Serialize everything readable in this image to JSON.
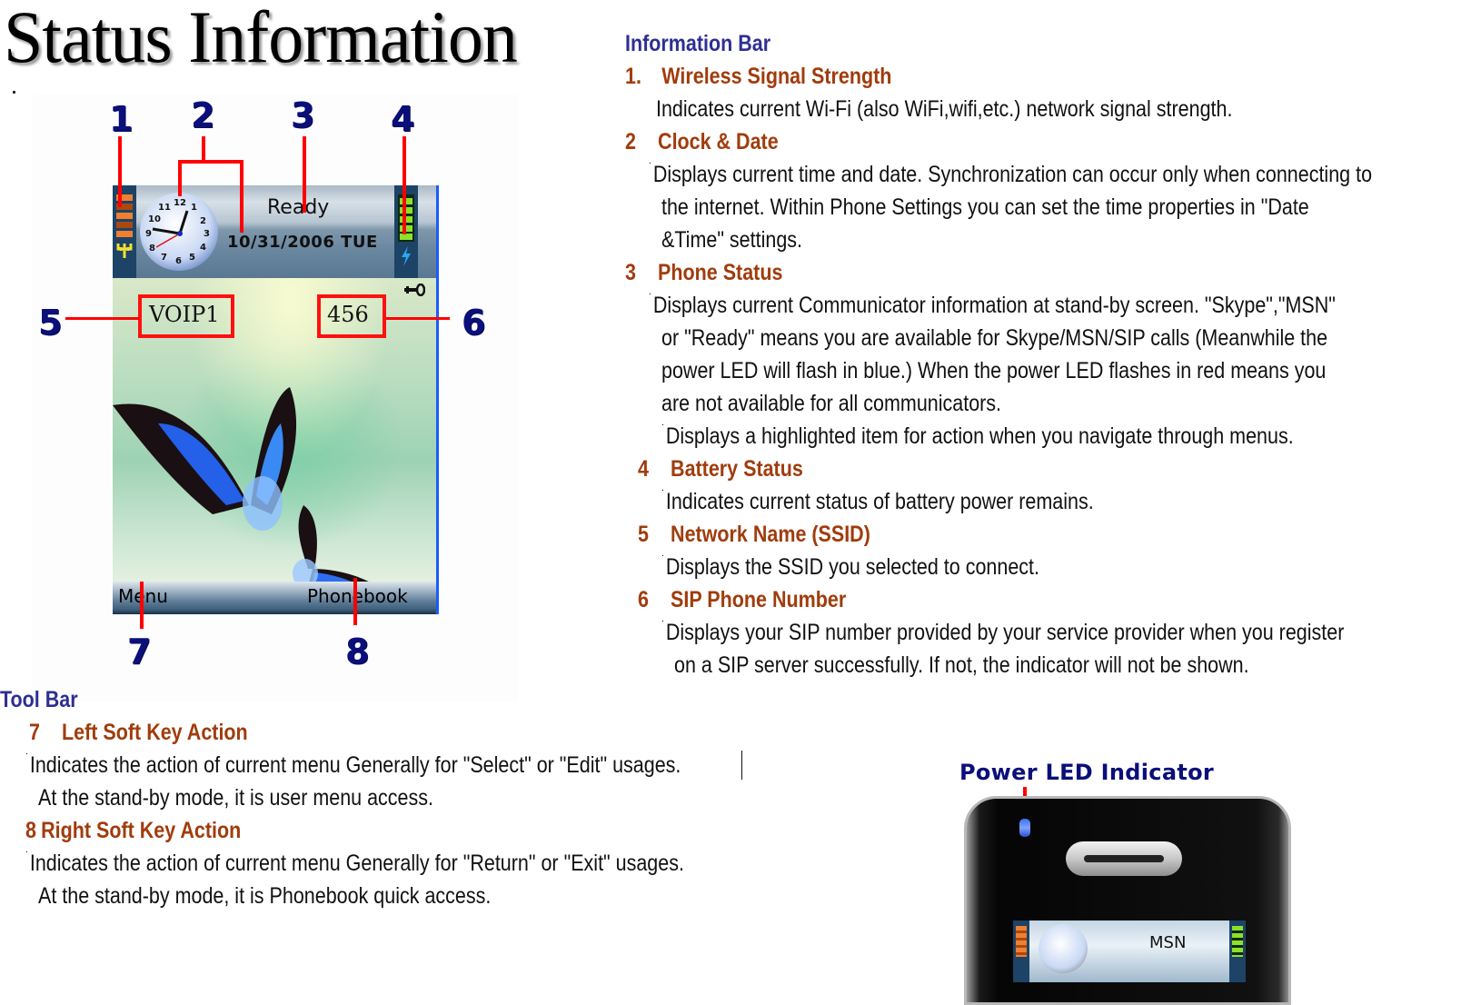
{
  "page": {
    "title": "Status Information"
  },
  "figure": {
    "callouts": [
      "1",
      "2",
      "3",
      "4",
      "5",
      "6",
      "7",
      "8"
    ],
    "status_bar": {
      "icons": {
        "signal": "wifi-signal-bars-icon",
        "antenna": "antenna-icon",
        "clock": "analog-clock-icon",
        "battery": "battery-bars-icon",
        "charging": "lightning-bolt-icon",
        "key": "key-icon"
      },
      "clock_numbers": [
        "12",
        "1",
        "2",
        "3",
        "4",
        "5",
        "6",
        "7",
        "8",
        "9",
        "10",
        "11"
      ],
      "status": "Ready",
      "date": "10/31/2006 TUE"
    },
    "network_name": "VOIP1",
    "sip_number": "456",
    "soft_keys": {
      "left": "Menu",
      "right": "Phonebook"
    }
  },
  "information_bar": {
    "heading": "Information Bar",
    "items": [
      {
        "number": "1.",
        "title": "Wireless Signal Strength",
        "lines": [
          "Indicates current Wi-Fi (also WiFi,wifi,etc.) network signal strength."
        ]
      },
      {
        "number": "2",
        "title": "Clock & Date",
        "lines": [
          "Displays current time and date. Synchronization can occur only when connecting to",
          "the internet.     Within Phone Settings you can set the time properties in \"Date",
          "&Time\" settings."
        ]
      },
      {
        "number": "3",
        "title": "Phone Status",
        "lines": [
          "Displays current Communicator information at stand-by screen. \"Skype\",\"MSN\"",
          "or \"Ready\" means you are available for Skype/MSN/SIP calls (Meanwhile the",
          "power LED will flash in blue.) When the power LED flashes in red means you",
          "are not available for all communicators.",
          "Displays a highlighted item for action when you navigate through menus."
        ]
      },
      {
        "number": "4",
        "title": "Battery Status",
        "lines": [
          "Indicates current status of battery power remains."
        ]
      },
      {
        "number": "5",
        "title": "Network Name (SSID)",
        "lines": [
          "Displays the SSID you selected to connect."
        ]
      },
      {
        "number": "6",
        "title": "SIP Phone Number",
        "lines": [
          "Displays your SIP number provided by your service provider when you register",
          "on a SIP server successfully. If not, the indicator will not be shown."
        ]
      }
    ]
  },
  "tool_bar": {
    "heading": "Tool Bar",
    "items": [
      {
        "number": "7",
        "title": "Left Soft Key Action",
        "lines": [
          "Indicates the action of current menu Generally for \"Select\" or \"Edit\" usages.",
          "At the stand-by mode, it is user menu access."
        ]
      },
      {
        "number": "8",
        "title": "Right Soft Key Action",
        "lines": [
          "Indicates the action of current menu Generally for \"Return\" or \"Exit\" usages.",
          "At the stand-by mode, it is Phonebook quick access."
        ]
      }
    ]
  },
  "power_led": {
    "title": "Power LED Indicator",
    "screen_status": "MSN",
    "led_color": "#3d6ff0"
  },
  "colors": {
    "section_heading": "#2e2f91",
    "item_heading": "#a03c0c",
    "callout_number": "#0a0f7a",
    "callout_line": "#ff0000"
  }
}
